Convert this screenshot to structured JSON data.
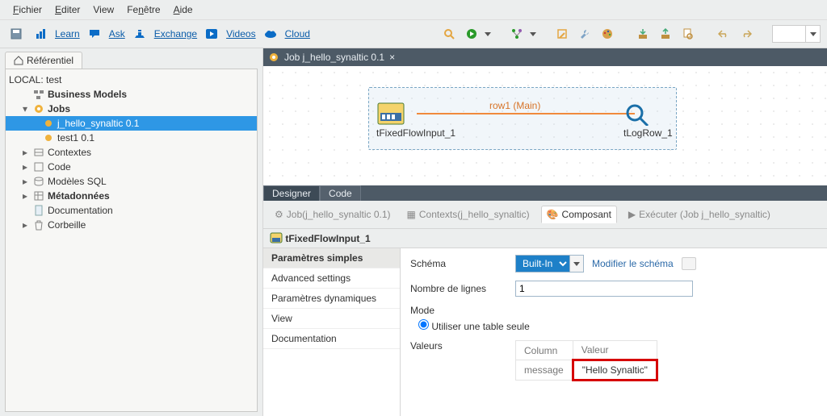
{
  "menu": {
    "fichier": "Fichier",
    "editer": "Editer",
    "view": "View",
    "fenetre": "Fenêtre",
    "aide": "Aide"
  },
  "links": {
    "learn": "Learn",
    "ask": "Ask",
    "exchange": "Exchange",
    "videos": "Videos",
    "cloud": "Cloud"
  },
  "referentiel": {
    "tab": "Référentiel",
    "local_label": "LOCAL: test",
    "business_models": "Business Models",
    "jobs": "Jobs",
    "job1": "j_hello_synaltic 0.1",
    "job2": "test1 0.1",
    "contextes": "Contextes",
    "code": "Code",
    "modeles_sql": "Modèles SQL",
    "metadonnees": "Métadonnées",
    "documentation": "Documentation",
    "corbeille": "Corbeille"
  },
  "editor": {
    "tab_title": "Job j_hello_synaltic 0.1",
    "node_in": "tFixedFlowInput_1",
    "node_out": "tLogRow_1",
    "wire_label": "row1 (Main)",
    "designer": "Designer",
    "code_tab": "Code"
  },
  "props": {
    "tab_job": "Job(j_hello_synaltic 0.1)",
    "tab_contexts": "Contexts(j_hello_synaltic)",
    "tab_composant": "Composant",
    "tab_executer": "Exécuter (Job j_hello_synaltic)",
    "header": "tFixedFlowInput_1",
    "side": {
      "simples": "Paramètres simples",
      "advanced": "Advanced settings",
      "dyn": "Paramètres dynamiques",
      "view": "View",
      "doc": "Documentation"
    },
    "form": {
      "schema_label": "Schéma",
      "schema_value": "Built-In",
      "modifier": "Modifier le schéma",
      "lignes_label": "Nombre de lignes",
      "lignes_value": "1",
      "mode_label": "Mode",
      "mode_radio": "Utiliser une table seule",
      "valeurs_label": "Valeurs",
      "col_column": "Column",
      "col_valeur": "Valeur",
      "row_column": "message",
      "row_valeur": "\"Hello Synaltic\""
    }
  }
}
